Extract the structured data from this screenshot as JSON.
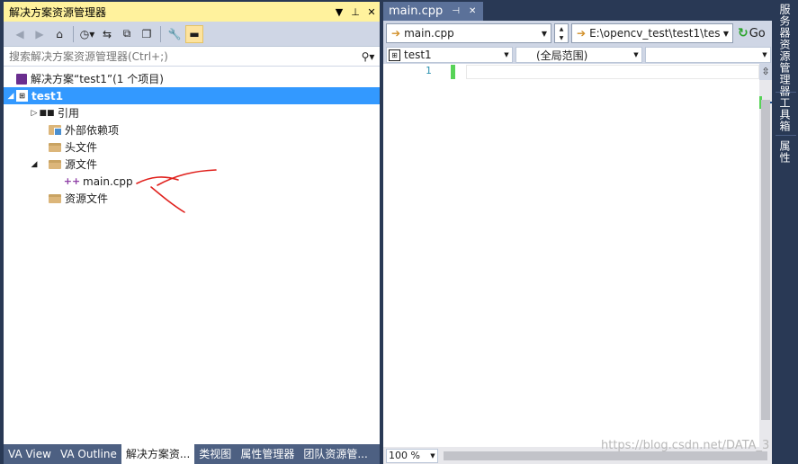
{
  "solution_explorer": {
    "title": "解决方案资源管理器",
    "title_buttons": {
      "dropdown": "▼",
      "pin": "ᴘ",
      "close": "✕"
    },
    "search_placeholder": "搜索解决方案资源管理器(Ctrl+;)",
    "tree": {
      "solution_label": "解决方案“test1”(1 个项目)",
      "project_label": "test1",
      "references_label": "引用",
      "external_deps_label": "外部依赖项",
      "header_files_label": "头文件",
      "source_files_label": "源文件",
      "main_file_label": "main.cpp",
      "resource_files_label": "资源文件"
    }
  },
  "bottom_tabs": [
    {
      "label": "VA View"
    },
    {
      "label": "VA Outline"
    },
    {
      "label": "解决方案资..."
    },
    {
      "label": "类视图"
    },
    {
      "label": "属性管理器"
    },
    {
      "label": "团队资源管..."
    }
  ],
  "editor": {
    "tab_label": "main.cpp",
    "nav_file": "main.cpp",
    "nav_path": "E:\\opencv_test\\test1\\tes",
    "go_label": "Go",
    "scope_project": "test1",
    "scope_global": "(全局范围)",
    "scope_member": "",
    "line_number": "1",
    "zoom": "100 %"
  },
  "side_tabs": [
    {
      "label": "服务器资源管理器"
    },
    {
      "label": "工具箱"
    },
    {
      "label": "属性"
    }
  ],
  "watermark": "https://blog.csdn.net/DATA_3",
  "colors": {
    "ide_background": "#293955",
    "title_active": "#fff29d",
    "selection": "#3399ff",
    "annotation": "#e0201c"
  }
}
